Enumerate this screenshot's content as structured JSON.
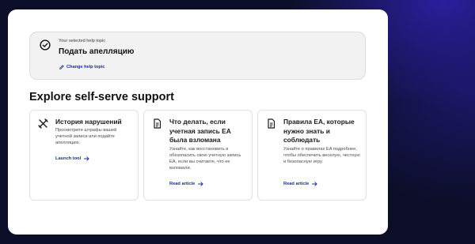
{
  "selected_topic": {
    "caption": "Your selected help topic",
    "title": "Подать апелляцию",
    "change_label": "Change help topic",
    "check_icon": "check-circle-icon",
    "change_icon": "pencil-icon"
  },
  "section": {
    "heading": "Explore self-serve support"
  },
  "cards": [
    {
      "icon": "tools-icon",
      "title": "История нарушений",
      "description": "Просмотрите штрафы вашей учетной записи или подайте апелляцию.",
      "link": "Launch tool"
    },
    {
      "icon": "document-icon",
      "title": "Что делать, если учетная запись EA была взломана",
      "description": "Узнайте, как восстановить и обезопасить свою учетную запись EA, если вы считаете, что ее взломали.",
      "link": "Read article"
    },
    {
      "icon": "document-icon",
      "title": "Правила EA, которые нужно знать и соблюдать",
      "description": "Узнайте о правилах EA подробнее, чтобы обеспечить веселую, честную и безопасную игру.",
      "link": "Read article"
    }
  ],
  "colors": {
    "link": "#1b2aa8",
    "background": "#0c0e28",
    "accent_glow": "#2a1f9e"
  }
}
